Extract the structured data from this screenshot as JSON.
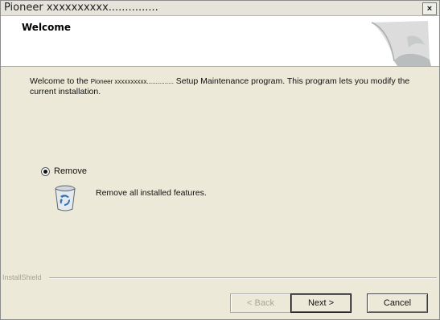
{
  "window": {
    "title": "Pioneer xxxxxxxxxx...............",
    "close_label": "×"
  },
  "header": {
    "title": "Welcome"
  },
  "body": {
    "intro_prefix": "Welcome to the",
    "product_name": "Pioneer xxxxxxxxxx...............",
    "intro_suffix": "Setup Maintenance program. This program lets you modify the current installation."
  },
  "options": {
    "remove_label": "Remove",
    "remove_selected": true,
    "remove_description": "Remove all installed features."
  },
  "footer": {
    "brand": "InstallShield"
  },
  "buttons": {
    "back": "< Back",
    "next": "Next >",
    "cancel": "Cancel"
  },
  "colors": {
    "dialog_bg": "#ece9d8",
    "header_bg": "#ffffff",
    "disabled_text": "#a8a69c"
  }
}
